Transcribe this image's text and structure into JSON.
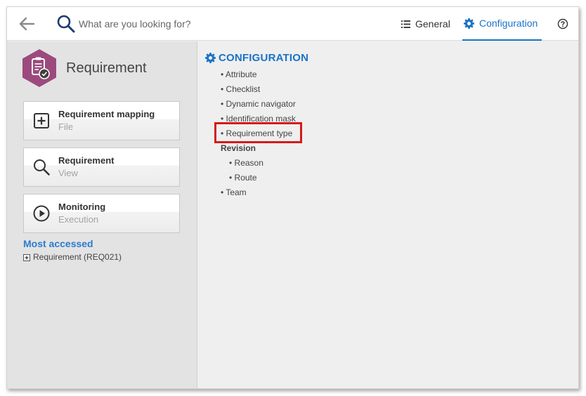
{
  "search": {
    "placeholder": "What are you looking for?"
  },
  "tabs": {
    "general": "General",
    "configuration": "Configuration"
  },
  "module": {
    "title": "Requirement",
    "icon_color": "#9c4a7e"
  },
  "cards": [
    {
      "title": "Requirement mapping",
      "subtitle": "File",
      "icon": "plus-square-icon"
    },
    {
      "title": "Requirement",
      "subtitle": "View",
      "icon": "search-icon"
    },
    {
      "title": "Monitoring",
      "subtitle": "Execution",
      "icon": "play-circle-icon"
    }
  ],
  "most_accessed": {
    "label": "Most accessed",
    "items": [
      {
        "label": "Requirement (REQ021)"
      }
    ]
  },
  "config": {
    "heading": "CONFIGURATION",
    "items": {
      "attribute": "• Attribute",
      "checklist": "• Checklist",
      "dynamic_navigator": "• Dynamic navigator",
      "identification_mask": "• Identification mask",
      "requirement_type": "• Requirement type",
      "revision_group": "Revision",
      "reason": "• Reason",
      "route": "• Route",
      "team": "• Team"
    }
  },
  "colors": {
    "accent": "#1a73c8",
    "highlight": "#d61a1a"
  }
}
